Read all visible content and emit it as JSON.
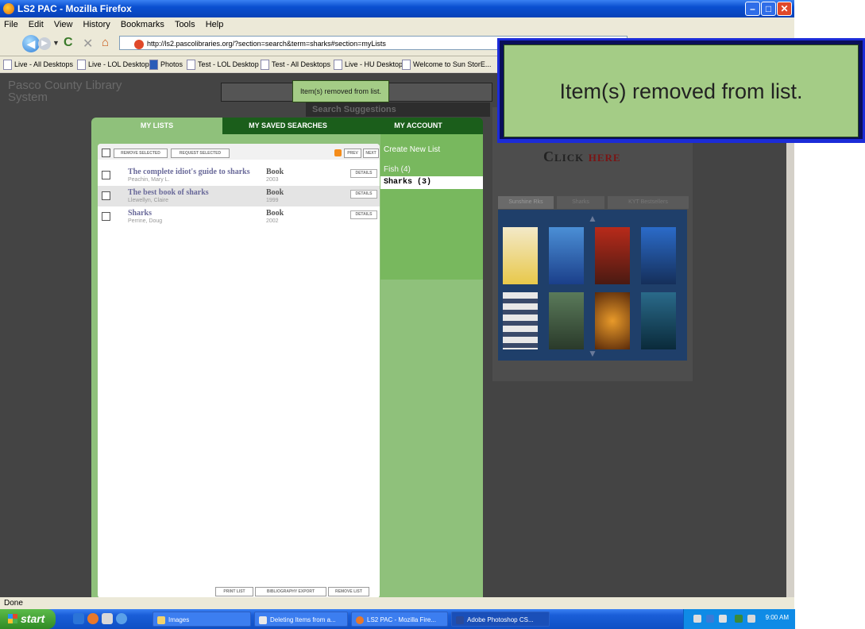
{
  "window": {
    "title": "LS2 PAC - Mozilla Firefox"
  },
  "menu": [
    "File",
    "Edit",
    "View",
    "History",
    "Bookmarks",
    "Tools",
    "Help"
  ],
  "url": "http://ls2.pascolibraries.org/?section=search&term=sharks#section=myLists",
  "bookmarks": [
    "Live - All Desktops",
    "Live - LOL Desktop",
    "Photos",
    "Test - LOL Desktop",
    "Test - All Desktops",
    "Live - HU Desktop",
    "Welcome to Sun StorE..."
  ],
  "site": {
    "logo_line1": "Pasco County Library",
    "logo_line2": "System",
    "search_suggestions": "Search Suggestions",
    "tooltip": "Item(s) removed from list."
  },
  "tabs": {
    "my_lists": "MY LISTS",
    "saved_searches": "MY SAVED SEARCHES",
    "my_account": "MY ACCOUNT",
    "close": "x"
  },
  "actions": {
    "remove_selected": "REMOVE SELECTED",
    "request_selected": "REQUEST SELECTED",
    "prev": "PREV",
    "next": "NEXT"
  },
  "items": [
    {
      "title": "The complete idiot's guide to sharks",
      "author": "Peachin, Mary L.",
      "format": "Book",
      "year": "2003",
      "details": "DETAILS"
    },
    {
      "title": "The best book of sharks",
      "author": "Llewellyn, Claire",
      "format": "Book",
      "year": "1999",
      "details": "DETAILS"
    },
    {
      "title": "Sharks",
      "author": "Perrine, Doug",
      "format": "Book",
      "year": "2002",
      "details": "DETAILS"
    }
  ],
  "footer": {
    "print": "PRINT LIST",
    "bibliography": "BIBLIOGRAPHY EXPORT",
    "remove_list": "REMOVE LIST"
  },
  "side": {
    "create": "Create New List",
    "lists": [
      "Fish (4)",
      "Sharks (3)"
    ]
  },
  "promo": {
    "click": "Click",
    "here": "here"
  },
  "right_tabs": [
    "Sunshine Rks",
    "Sharks",
    "KYT Bestsellers"
  ],
  "status": "Done",
  "taskbar": {
    "start": "start",
    "tasks": [
      "Images",
      "Deleting Items from a...",
      "LS2 PAC - Mozilla Fire...",
      "Adobe Photoshop CS..."
    ],
    "clock": "9:00 AM"
  },
  "callout": "Item(s) removed from list."
}
